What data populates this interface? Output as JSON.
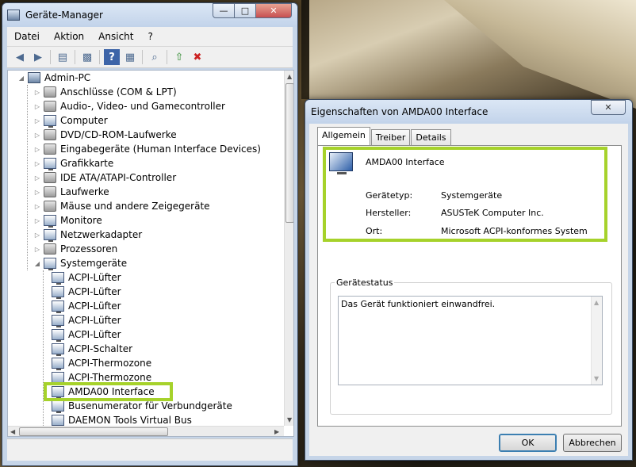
{
  "device_manager": {
    "title": "Geräte-Manager",
    "menu": [
      "Datei",
      "Aktion",
      "Ansicht",
      "?"
    ],
    "toolbar_icons": [
      "back-arrow-icon",
      "forward-arrow-icon",
      "show-hide-console-tree-icon",
      "properties-icon",
      "help-icon",
      "action-pane-icon",
      "scan-hardware-icon",
      "update-driver-icon",
      "uninstall-icon"
    ],
    "tree": {
      "root": "Admin-PC",
      "categories": [
        "Anschlüsse (COM & LPT)",
        "Audio-, Video- und Gamecontroller",
        "Computer",
        "DVD/CD-ROM-Laufwerke",
        "Eingabegeräte (Human Interface Devices)",
        "Grafikkarte",
        "IDE ATA/ATAPI-Controller",
        "Laufwerke",
        "Mäuse und andere Zeigegeräte",
        "Monitore",
        "Netzwerkadapter",
        "Prozessoren",
        "Systemgeräte"
      ],
      "system_devices": [
        "ACPI-Lüfter",
        "ACPI-Lüfter",
        "ACPI-Lüfter",
        "ACPI-Lüfter",
        "ACPI-Lüfter",
        "ACPI-Schalter",
        "ACPI-Thermozone",
        "ACPI-Thermozone",
        "AMDA00 Interface",
        "Busenumerator für Verbundgeräte",
        "DAEMON Tools Virtual Bus"
      ],
      "highlighted": "AMDA00 Interface"
    }
  },
  "properties": {
    "title": "Eigenschaften von AMDA00 Interface",
    "tabs": [
      "Allgemein",
      "Treiber",
      "Details"
    ],
    "device_name": "AMDA00 Interface",
    "fields": [
      {
        "label": "Gerätetyp:",
        "value": "Systemgeräte"
      },
      {
        "label": "Hersteller:",
        "value": "ASUSTeK Computer Inc."
      },
      {
        "label": "Ort:",
        "value": "Microsoft ACPI-konformes System"
      }
    ],
    "status_label": "Gerätestatus",
    "status_text": "Das Gerät funktioniert einwandfrei.",
    "ok_label": "OK",
    "cancel_label": "Abbrechen"
  },
  "colors": {
    "highlight": "#a6d22b",
    "window_frame": "#c6d5e8"
  }
}
